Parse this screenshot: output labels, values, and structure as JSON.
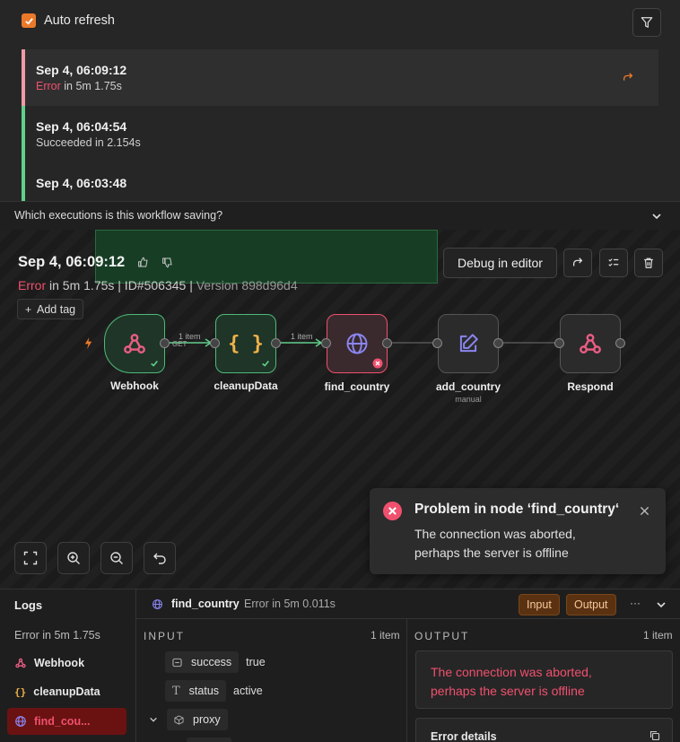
{
  "executions": {
    "auto_refresh_label": "Auto refresh",
    "items": [
      {
        "date": "Sep 4, 06:09:12",
        "status": "Error",
        "status_rest": " in 5m 1.75s"
      },
      {
        "date": "Sep 4, 06:04:54",
        "status_text": "Succeeded in 2.154s"
      },
      {
        "date": "Sep 4, 06:03:48"
      }
    ],
    "saving_question": "Which executions is this workflow saving?"
  },
  "header": {
    "date": "Sep 4, 06:09:12",
    "status": "Error",
    "details": " in 5m 1.75s | ID#506345 | ",
    "version": "Version 898d96d4",
    "add_tag": "Add tag",
    "debug_label": "Debug in editor"
  },
  "nodes": [
    {
      "label": "Webhook",
      "icon": "webhook-icon"
    },
    {
      "label": "cleanupData",
      "icon": "braces-icon"
    },
    {
      "label": "find_country",
      "icon": "globe-icon"
    },
    {
      "label": "add_country",
      "sub": "manual",
      "icon": "edit-icon"
    },
    {
      "label": "Respond",
      "icon": "webhook-icon"
    }
  ],
  "connections": [
    {
      "items": "1 item",
      "method": "GET"
    },
    {
      "items": "1 item"
    }
  ],
  "toast": {
    "title": "Problem in node ‘find_country‘",
    "line1": "The connection was aborted,",
    "line2": "perhaps the server is offline"
  },
  "logs": {
    "title": "Logs",
    "summary": "Error in 5m 1.75s",
    "tree": [
      "Webhook",
      "cleanupData",
      "find_cou..."
    ],
    "node_name": "find_country",
    "node_status": "Error in 5m 0.011s",
    "input_tab": "Input",
    "output_tab": "Output",
    "more": "···",
    "input_label": "INPUT",
    "input_count": "1 item",
    "fields": [
      {
        "key": "success",
        "value": "true"
      },
      {
        "key": "status",
        "value": "active"
      },
      {
        "key": "proxy",
        "value": ""
      }
    ],
    "output_label": "OUTPUT",
    "output_count": "1 item",
    "error_line1": "The connection was aborted,",
    "error_line2": "perhaps the server is offline",
    "error_details": "Error details"
  },
  "colors": {
    "accent": "#ea7a2a",
    "error": "#f0506e",
    "success": "#5fd08a"
  }
}
